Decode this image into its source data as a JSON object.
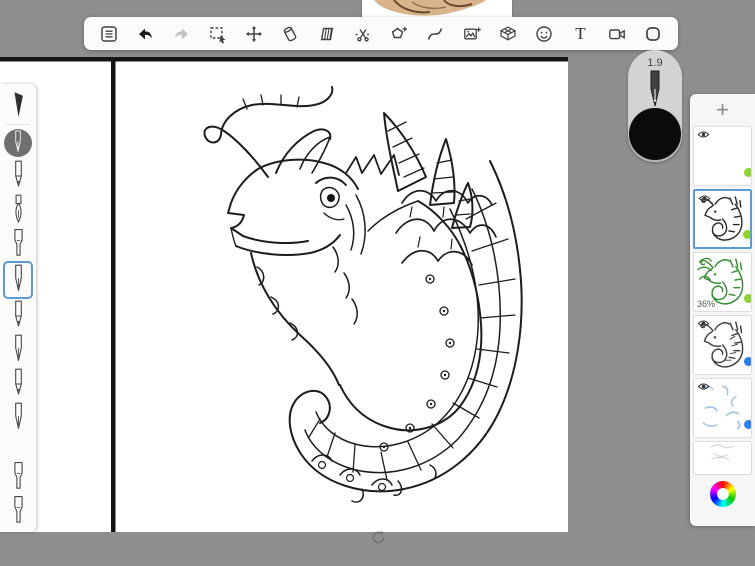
{
  "window": {
    "background_color": "#8e8e8e"
  },
  "toolbar": {
    "tools": [
      "menu",
      "undo",
      "redo",
      "rectangle-select",
      "move",
      "eraser",
      "fill-pattern",
      "cut",
      "shape-tool",
      "stroke-curve",
      "import-image",
      "perspective-grid",
      "sticker",
      "text-tool",
      "video-record",
      "mask-shape"
    ],
    "text_tool_label": "T"
  },
  "brush_preview": {
    "size_label": "1.9",
    "selected_color": "#0b0b0b"
  },
  "left_toolbar": {
    "tools": [
      "airbrush",
      "active-pen",
      "pencil",
      "paint-brush",
      "marker",
      "fountain-pen",
      "pencil-2",
      "ink-pen",
      "pencil-3",
      "nib-pen",
      "marker-2",
      "marker-3"
    ],
    "selected_tool": "fountain-pen",
    "selection_color": "#5b9bd5"
  },
  "layers_panel": {
    "add_button_label": "+",
    "layers": [
      {
        "name": "layer-top",
        "visible": true,
        "dot_color": "#8ed331",
        "content": "blank"
      },
      {
        "name": "layer-lineart",
        "visible": true,
        "dot_color": "#8ed331",
        "content": "dragon-line-art",
        "selected": true
      },
      {
        "name": "layer-green-sketch",
        "visible": false,
        "dot_color": "#8ed331",
        "content": "green-sketch",
        "opacity_label": "36%"
      },
      {
        "name": "layer-dark-sketch",
        "visible": true,
        "dot_color": "#2d7ff0",
        "content": "dark-sketch"
      },
      {
        "name": "layer-blue-marks",
        "visible": true,
        "dot_color": "#2d7ff0",
        "content": "blue-marks"
      },
      {
        "name": "layer-faint-sketch",
        "visible": false,
        "content": "faint-sketch"
      }
    ]
  },
  "canvas": {
    "artwork_description": "black line-art drawing of a dragon head with curled antennae, striped horns and a scaled curled neck",
    "page_border_color": "#141414"
  }
}
